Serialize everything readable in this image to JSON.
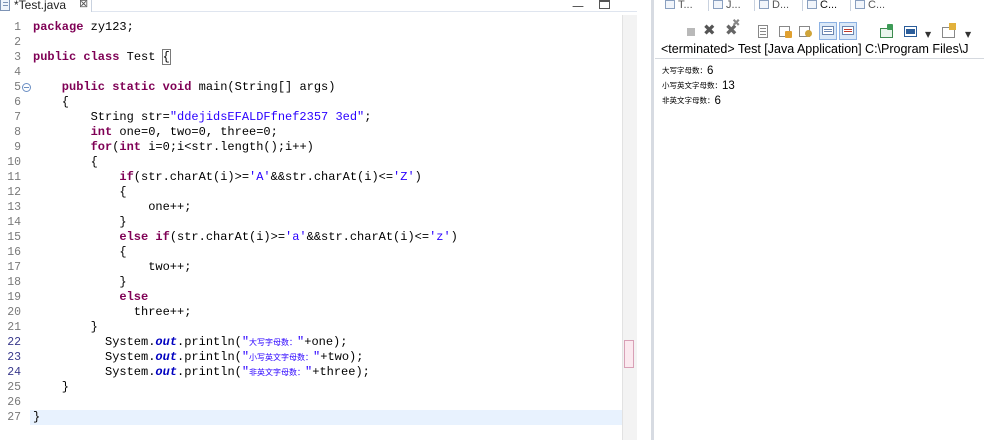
{
  "editor": {
    "tab_label": "*Test.java",
    "close_glyph": "⊠",
    "minimize_glyph": "—",
    "line_numbers": [
      "1",
      "2",
      "3",
      "4",
      "5",
      "6",
      "7",
      "8",
      "9",
      "10",
      "11",
      "12",
      "13",
      "14",
      "15",
      "16",
      "17",
      "18",
      "19",
      "20",
      "21",
      "22",
      "23",
      "24",
      "25",
      "26",
      "27"
    ],
    "fold_marker_line": "5",
    "caret_line": "27",
    "code": {
      "l1": "package zy123;",
      "l3_kw": "public class",
      "l3_name": " Test ",
      "l3_brace": "{",
      "l5_kw": "public static void",
      "l5_rest": " main(String[] args)",
      "l6": "{",
      "l7_a": "String str=",
      "l7_str": "\"ddejidsEFALDFfnef2357 3ed\"",
      "l7_end": ";",
      "l8_kw": "int",
      "l8_rest": " one=0, two=0, three=0;",
      "l9_kw1": "for",
      "l9_a": "(",
      "l9_kw2": "int",
      "l9_rest": " i=0;i<str.length();i++)",
      "l10": "{",
      "l11_kw": "if",
      "l11_a": "(str.charAt(i)>=",
      "l11_s1": "'A'",
      "l11_b": "&&str.charAt(i)<=",
      "l11_s2": "'Z'",
      "l11_c": ")",
      "l12": "{",
      "l13": "one++;",
      "l14": "}",
      "l15_kw": "else if",
      "l15_a": "(str.charAt(i)>=",
      "l15_s1": "'a'",
      "l15_b": "&&str.charAt(i)<=",
      "l15_s2": "'z'",
      "l15_c": ")",
      "l16": "{",
      "l17": "two++;",
      "l18": "}",
      "l19_kw": "else",
      "l20": "three++;",
      "l21": "}",
      "print_prefix": "System.",
      "print_field": "out",
      "print_method": ".println(",
      "l22_str_open": "\"",
      "l22_cjk": "大写字母数：",
      "l22_str_close": "\"",
      "l22_rest": "+one);",
      "l23_cjk": "小写英文字母数：",
      "l23_rest": "+two);",
      "l24_cjk": "非英文字母数：",
      "l24_rest": "+three);",
      "l25": "}",
      "l27": "}"
    }
  },
  "console": {
    "tabs": [
      {
        "label": "T...",
        "icon": "tasks-icon"
      },
      {
        "label": "J...",
        "icon": "javadoc-icon"
      },
      {
        "label": "D...",
        "icon": "declaration-icon"
      },
      {
        "label": "C...",
        "icon": "console-icon",
        "active": true
      },
      {
        "label": "C...",
        "icon": "coverage-icon"
      }
    ],
    "toolbar_icons": [
      "terminate-icon",
      "remove-launch-icon",
      "remove-all-icon",
      "scroll-lock-icon",
      "word-wrap-icon",
      "pin-icon",
      "show-stdout-icon",
      "show-stderr-icon",
      "open-console-icon",
      "display-selected-icon",
      "new-console-icon"
    ],
    "status": "<terminated> Test [Java Application] C:\\Program Files\\J",
    "output": [
      {
        "label": "大写字母数：",
        "value": "6"
      },
      {
        "label": "小写英文字母数：",
        "value": "13"
      },
      {
        "label": "非英文字母数：",
        "value": "6"
      }
    ]
  }
}
